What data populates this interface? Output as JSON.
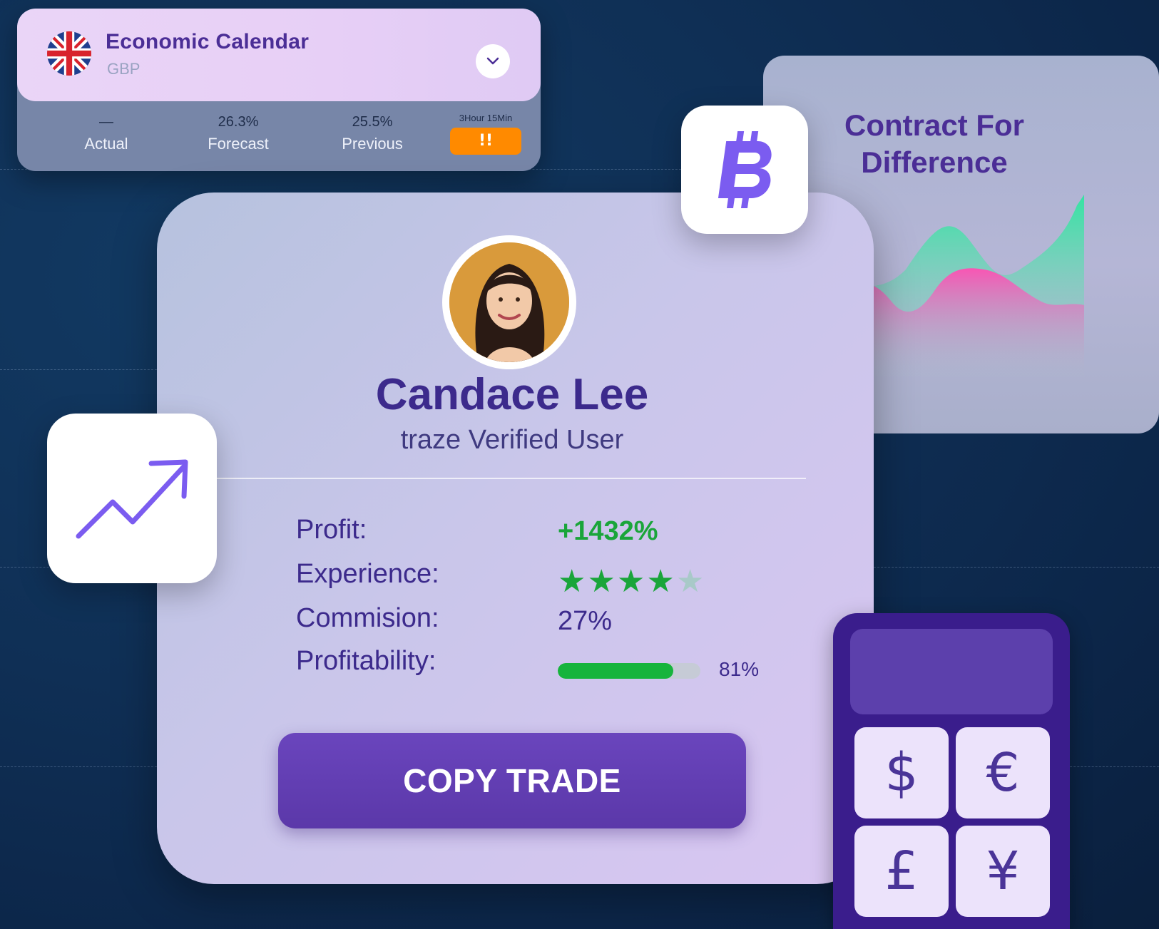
{
  "economic_calendar": {
    "title": "Economic Calendar",
    "currency": "GBP",
    "actual_value": "—",
    "actual_label": "Actual",
    "forecast_value": "26.3%",
    "forecast_label": "Forecast",
    "previous_value": "25.5%",
    "previous_label": "Previous",
    "countdown": "3Hour 15Min",
    "alert_badge": "!!"
  },
  "cfd": {
    "title_line1": "Contract For",
    "title_line2": "Difference"
  },
  "profile": {
    "name": "Candace Lee",
    "role": "traze Verified User",
    "profit_label": "Profit:",
    "profit_value": "+1432%",
    "experience_label": "Experience:",
    "experience_rating": 4,
    "experience_max": 5,
    "commission_label": "Commision:",
    "commission_value": "27%",
    "profitability_label": "Profitability:",
    "profitability_percent": 81,
    "profitability_text": "81%",
    "copy_button": "COPY TRADE"
  },
  "calculator": {
    "keys": [
      "$",
      "€",
      "£",
      "¥"
    ]
  },
  "colors": {
    "accent_purple": "#5b38a9",
    "profit_green": "#1aa53a",
    "alert_orange": "#ff8a00",
    "background": "#0f2f55"
  },
  "icons": [
    "uk-flag-icon",
    "chevron-down-icon",
    "bitcoin-icon",
    "trend-up-icon"
  ]
}
